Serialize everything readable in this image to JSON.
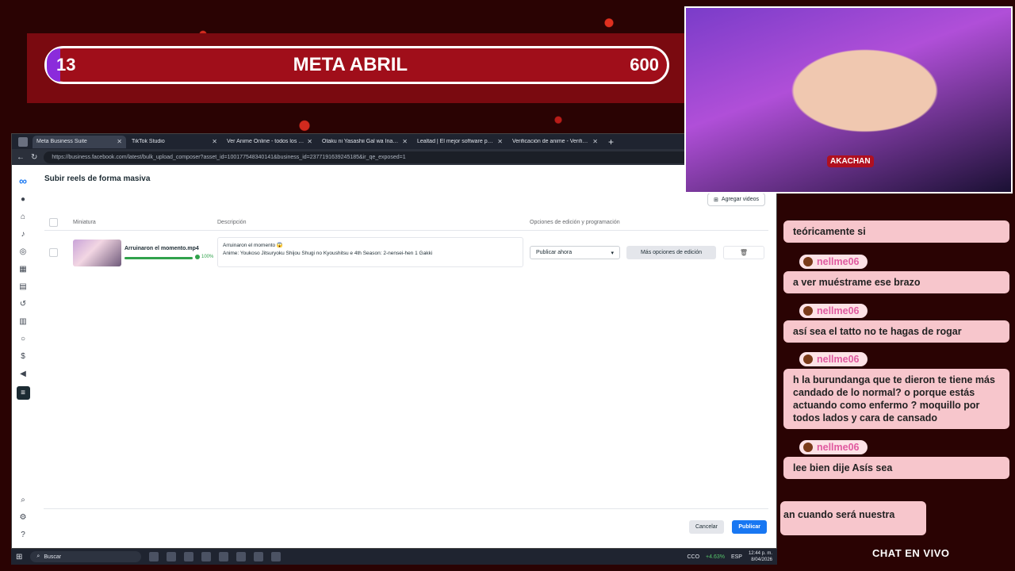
{
  "goal": {
    "current": "13",
    "title": "META ABRIL",
    "target": "600"
  },
  "browser": {
    "tabs": [
      {
        "label": "Meta Business Suite",
        "close": "✕",
        "active": true
      },
      {
        "label": "TikTok Studio",
        "close": "✕",
        "active": false
      },
      {
        "label": "Ver Anime Online - todos los anim",
        "close": "✕",
        "active": false
      },
      {
        "label": "Otaku ni Yasashii Gal wa Inai!? 1 S",
        "close": "✕",
        "active": false
      },
      {
        "label": "Lealtad | El mejor software para p",
        "close": "✕",
        "active": false
      },
      {
        "label": "Verificación de anime - Verificación",
        "close": "✕",
        "active": false
      }
    ],
    "new_tab": "+",
    "url": "https://business.facebook.com/latest/bulk_upload_composer?asset_id=100177548340141&business_id=2377191639245185&ir_qe_exposed=1"
  },
  "page": {
    "title": "Subir reels de forma masiva",
    "add_videos": "Agregar videos",
    "columns": {
      "thumbnail": "Miniatura",
      "description": "Descripción",
      "options": "Opciones de edición y programación"
    },
    "rows": [
      {
        "filename": "Arruinaron el momento.mp4",
        "progress": "100%",
        "progress_value": 1.0,
        "description_line1": "Arruinaron el momento 😱",
        "description_line2": "Anime: Youkoso Jitsuryoku Shijou Shugi no Kyoushitsu e 4th Season: 2-nensei-hen 1 Gakki",
        "schedule": "Publicar ahora",
        "more_options": "Más opciones de edición"
      }
    ],
    "cancel": "Cancelar",
    "publish": "Publicar"
  },
  "taskbar": {
    "search": "Buscar",
    "ticker": "CCO",
    "ticker_change": "+4.63%",
    "lang": "ESP",
    "time": "12:44 p. m.",
    "date": "8/04/2026"
  },
  "webcam": {
    "logo_text": "AKACHAN"
  },
  "chat": {
    "label": "CHAT EN VIVO",
    "messages": [
      {
        "user": "",
        "text": "teóricamente si"
      },
      {
        "user": "nellme06",
        "text": "a ver muéstrame ese brazo"
      },
      {
        "user": "nellme06",
        "text": "así sea el tatto no te hagas de rogar"
      },
      {
        "user": "nellme06",
        "text": "h la burundanga que te dieron te tiene más candado de lo normal? o porque estás actuando como enfermo ? moquillo por todos lados y cara de cansado"
      },
      {
        "user": "nellme06",
        "text": "lee bien dije Asís sea"
      },
      {
        "user": "",
        "text": "an cuando será nuestra"
      }
    ]
  },
  "colors": {
    "accent": "#1877f2",
    "goal_bg": "#a00e1a",
    "chat_bubble": "#f7c6cc",
    "username": "#e05aa0"
  }
}
